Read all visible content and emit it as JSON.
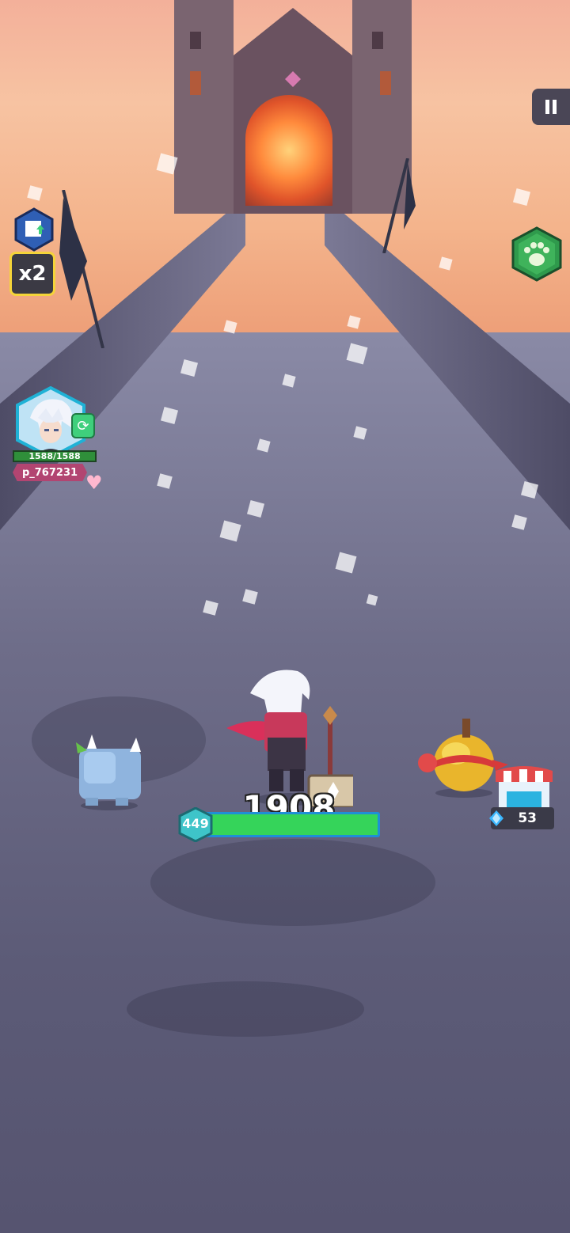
{
  "hud": {
    "multiplier": "x2",
    "pause_icon": "pause-icon",
    "pet_icon": "paw-icon",
    "cube_icon": "cube-upgrade-icon"
  },
  "hero": {
    "hp_text": "1588/1588",
    "name": "p_767231",
    "swap_icon": "swap-icon"
  },
  "player": {
    "power": "1908",
    "level": "449",
    "hp_fraction": 1.0
  },
  "shop": {
    "gem_count": "53",
    "icon": "shop-stall-icon"
  },
  "colors": {
    "hp_green": "#35d45a",
    "hp_border": "#1f8fd6",
    "name_tag": "#b24571",
    "x2_border": "#f4d439",
    "pet_button": "#2f9a4c"
  }
}
